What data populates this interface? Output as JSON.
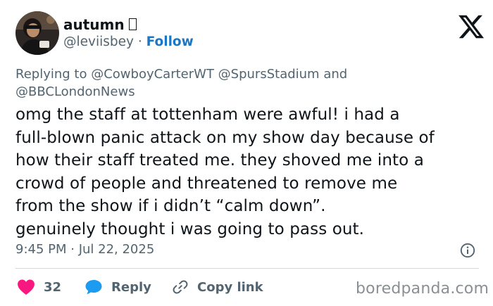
{
  "author": {
    "display_name": "autumn",
    "handle": "@leviisbey",
    "separator": "·",
    "follow_label": "Follow"
  },
  "reply_context": {
    "prefix": "Replying to",
    "mention_1": "@CowboyCarterWT",
    "mention_2": "@SpursStadium",
    "conjunction": "and",
    "mention_3": "@BBCLondonNews"
  },
  "tweet": {
    "lines": [
      "omg the staff at tottenham were awful! i had a",
      "full-blown panic attack on my show day because of",
      "how their staff treated me. they shoved me into a",
      "crowd of people and threatened to remove me",
      "from the show if i didn’t “calm down”.",
      "genuinely thought i was going to pass out."
    ]
  },
  "meta": {
    "timestamp": "9:45 PM · Jul 22, 2025"
  },
  "actions": {
    "like_count": "32",
    "reply_label": "Reply",
    "copy_link_label": "Copy link"
  },
  "watermark": "boredpanda.com",
  "icons": {
    "platform": "x-logo-icon",
    "like": "heart-icon",
    "reply": "speech-bubble-icon",
    "copy_link": "link-icon",
    "info": "info-icon"
  },
  "colors": {
    "text_primary": "#0f1419",
    "text_secondary": "#536471",
    "follow_blue": "#1d76c4",
    "like_pink": "#f91880",
    "reply_blue": "#1d9bf0",
    "divider": "#cfd9de",
    "watermark": "#8a8f94"
  }
}
